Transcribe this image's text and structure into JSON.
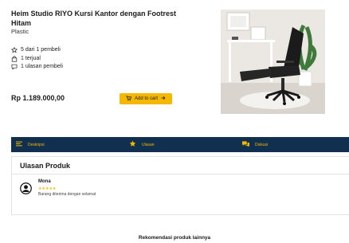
{
  "product": {
    "title": "Heim Studio RIYO Kursi Kantor dengan Footrest Hitam",
    "material": "Plastic",
    "stats": [
      {
        "icon": "star-outline-icon",
        "text": "5 dari 1 pembeli"
      },
      {
        "icon": "shopping-bag-icon",
        "text": "1 terjual"
      },
      {
        "icon": "chat-bubble-icon",
        "text": "1 ulasan pembeli"
      }
    ],
    "price": "Rp 1.189.000,00",
    "add_to_cart_label": "Add to cart",
    "image_alt": "black office chair with footrest"
  },
  "tabs": [
    {
      "label": "Deskripsi",
      "icon": "list-icon"
    },
    {
      "label": "Ulasan",
      "icon": "star-icon"
    },
    {
      "label": "Diskusi",
      "icon": "chat-icon"
    }
  ],
  "reviews": {
    "heading": "Ulasan Produk",
    "items": [
      {
        "name": "Mona",
        "rating": 5,
        "stars": "★★★★★",
        "text": "Barang diterima dengan selamat"
      }
    ]
  },
  "recommendations": {
    "heading": "Rekomendasi produk lainnya"
  },
  "colors": {
    "accent": "#f5b800",
    "nav_bg": "#11304f"
  }
}
